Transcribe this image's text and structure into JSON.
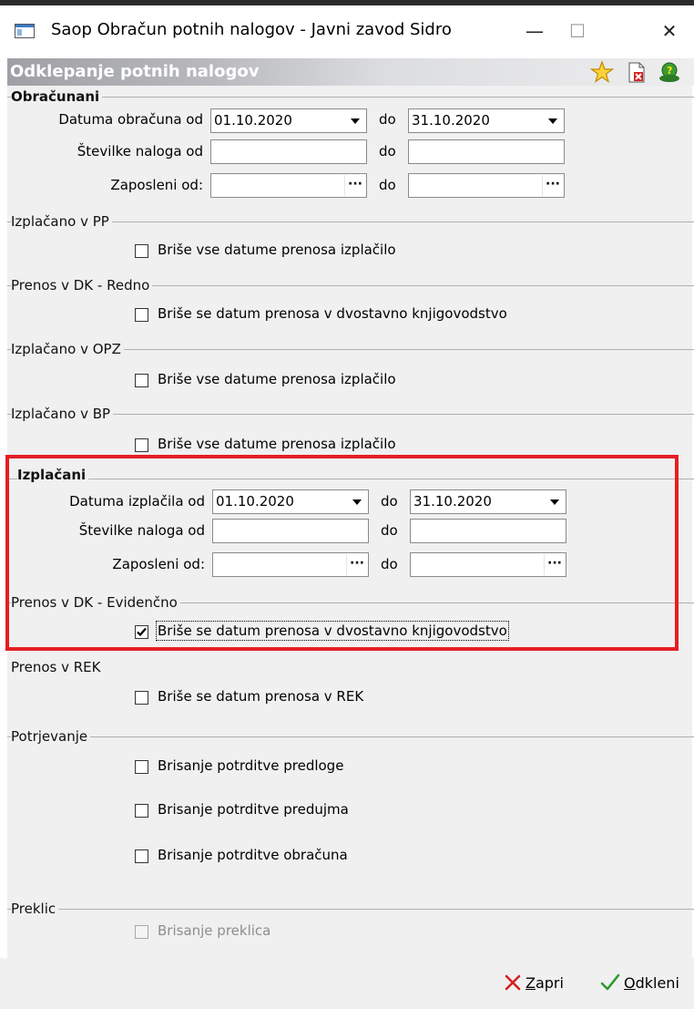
{
  "window": {
    "title": "Saop Obračun potnih nalogov - Javni zavod Sidro",
    "minimize_glyph": "—",
    "maximize_glyph": "☐",
    "close_glyph": "✕"
  },
  "header": {
    "title": "Odklepanje potnih nalogov",
    "icons": [
      "star-icon",
      "delete-document-icon",
      "help-person-icon"
    ]
  },
  "obracunani": {
    "title": "Obračunani",
    "date_label": "Datuma obračuna od",
    "date_from": "01.10.2020",
    "do1": "do",
    "date_to": "31.10.2020",
    "num_label": "Številke naloga od",
    "num_from": "",
    "do2": "do",
    "num_to": "",
    "emp_label": "Zaposleni od:",
    "emp_from": "",
    "do3": "do",
    "emp_to": ""
  },
  "izplacano_pp": {
    "title": "Izplačano v PP",
    "checkbox_label": "Briše vse datume prenosa izplačilo",
    "checked": false
  },
  "prenos_dk_redno": {
    "title": "Prenos v DK - Redno",
    "checkbox_label": "Briše se datum prenosa v dvostavno knjigovodstvo",
    "checked": false
  },
  "izplacano_opz": {
    "title": "Izplačano v OPZ",
    "checkbox_label": "Briše vse datume prenosa izplačilo",
    "checked": false
  },
  "izplacano_bp": {
    "title": "Izplačano v BP",
    "checkbox_label": "Briše vse datume prenosa izplačilo",
    "checked": false
  },
  "izplacani": {
    "title": "Izplačani",
    "date_label": "Datuma izplačila od",
    "date_from": "01.10.2020",
    "do1": "do",
    "date_to": "31.10.2020",
    "num_label": "Številke naloga od",
    "num_from": "",
    "do2": "do",
    "num_to": "",
    "emp_label": "Zaposleni od:",
    "emp_from": "",
    "do3": "do",
    "emp_to": ""
  },
  "prenos_dk_evidencno": {
    "title": "Prenos v DK - Evidenčno",
    "checkbox_label": "Briše se datum prenosa v dvostavno knjigovodstvo",
    "checked": true
  },
  "prenos_rek": {
    "title": "Prenos v REK",
    "checkbox_label": "Briše se datum prenosa v REK",
    "checked": false
  },
  "potrjevanje": {
    "title": "Potrjevanje",
    "items": [
      {
        "label": "Brisanje potrditve predloge",
        "checked": false
      },
      {
        "label": "Brisanje potrditve predujma",
        "checked": false
      },
      {
        "label": "Brisanje potrditve obračuna",
        "checked": false
      }
    ]
  },
  "preklic": {
    "title": "Preklic",
    "checkbox_label": "Brisanje preklica",
    "checked": false,
    "disabled": true
  },
  "footer": {
    "close_label": "Zapri",
    "close_mnemonic": "Z",
    "close_rest": "apri",
    "unlock_label": "Odkleni",
    "unlock_mnemonic": "O",
    "unlock_rest": "dkleni"
  },
  "colors": {
    "highlight_box": "#e51e25",
    "panel_bg": "#f0f0f0",
    "check_green": "#2e9a2e",
    "close_red": "#d62020"
  }
}
